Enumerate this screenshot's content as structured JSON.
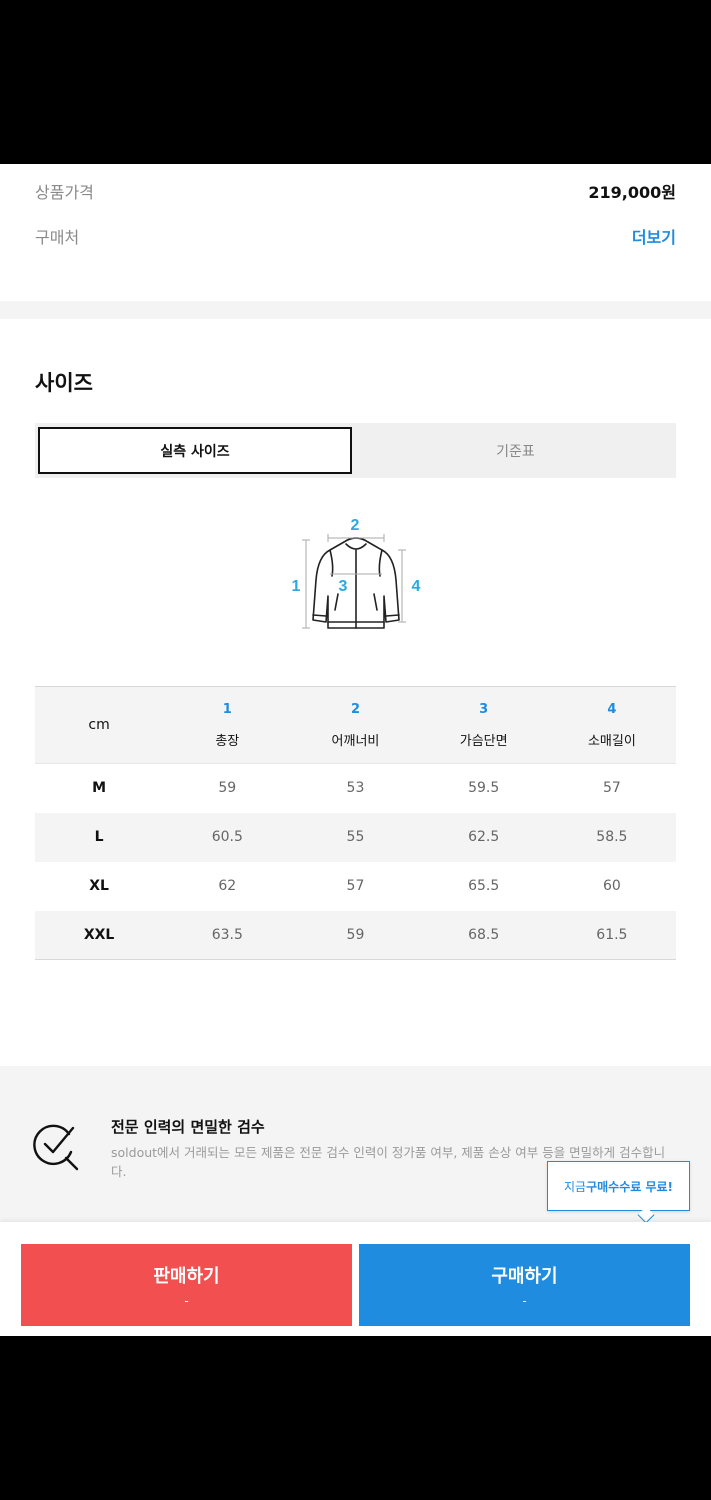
{
  "info": {
    "price_label": "상품가격",
    "price_value": "219,000원",
    "store_label": "구매처",
    "store_link": "더보기"
  },
  "size_section": {
    "title": "사이즈",
    "tabs": [
      {
        "label": "실측 사이즈",
        "active": true
      },
      {
        "label": "기준표",
        "active": false
      }
    ],
    "diagram_labels": [
      "1",
      "2",
      "3",
      "4"
    ]
  },
  "size_table": {
    "unit": "cm",
    "columns": [
      {
        "num": "1",
        "name": "총장"
      },
      {
        "num": "2",
        "name": "어깨너비"
      },
      {
        "num": "3",
        "name": "가슴단면"
      },
      {
        "num": "4",
        "name": "소매길이"
      }
    ],
    "rows": [
      {
        "size": "M",
        "values": [
          "59",
          "53",
          "59.5",
          "57"
        ]
      },
      {
        "size": "L",
        "values": [
          "60.5",
          "55",
          "62.5",
          "58.5"
        ]
      },
      {
        "size": "XL",
        "values": [
          "62",
          "57",
          "65.5",
          "60"
        ]
      },
      {
        "size": "XXL",
        "values": [
          "63.5",
          "59",
          "68.5",
          "61.5"
        ]
      }
    ]
  },
  "inspection": {
    "title": "전문 인력의 면밀한 검수",
    "description": "soldout에서 거래되는 모든 제품은 전문 검수 인력이 정가품 여부, 제품 손상 여부 등을 면밀하게 검수합니다."
  },
  "tooltip": {
    "prefix": "지금 ",
    "emphasis": "구매수수료 무료!"
  },
  "actions": {
    "sell_label": "판매하기",
    "sell_sub": "-",
    "buy_label": "구매하기",
    "buy_sub": "-"
  },
  "colors": {
    "accent": "#1f8ce0",
    "sell": "#f25050",
    "buy": "#1f8ce0"
  }
}
